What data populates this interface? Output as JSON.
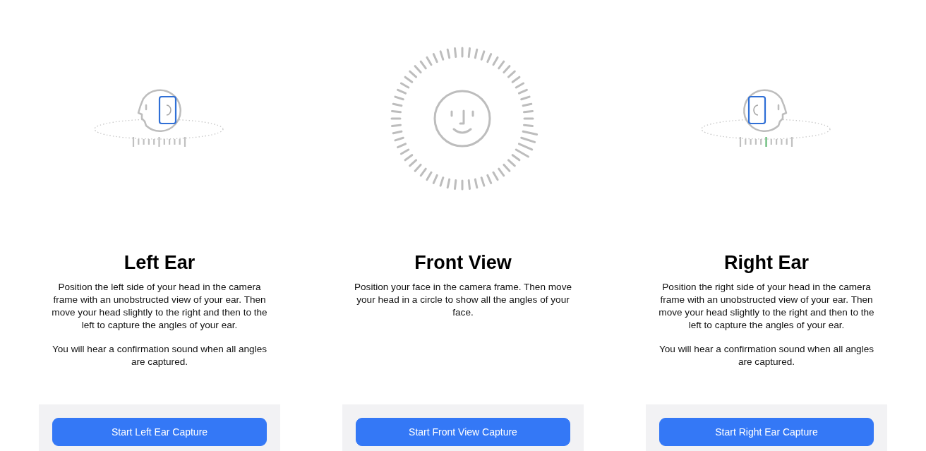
{
  "panels": [
    {
      "kind": "left-ear",
      "title": "Left Ear",
      "paragraphs": [
        "Position the left side of your head in the camera frame with an unobstructed view of your ear. Then move your head slightly to the right and then to the left to capture the angles of your ear.",
        "You will hear a confirmation sound when all angles are captured."
      ],
      "button": "Start Left Ear Capture"
    },
    {
      "kind": "front",
      "title": "Front View",
      "paragraphs": [
        "Position your face in the camera frame. Then move your head in a circle to show all the angles of your face."
      ],
      "button": "Start Front View Capture"
    },
    {
      "kind": "right-ear",
      "title": "Right Ear",
      "paragraphs": [
        "Position the right side of your head in the camera frame with an unobstructed view of your ear. Then move your head slightly to the right and then to the left to capture the angles of your ear.",
        "You will hear a confirmation sound when all angles are captured."
      ],
      "button": "Start Right Ear Capture"
    }
  ]
}
